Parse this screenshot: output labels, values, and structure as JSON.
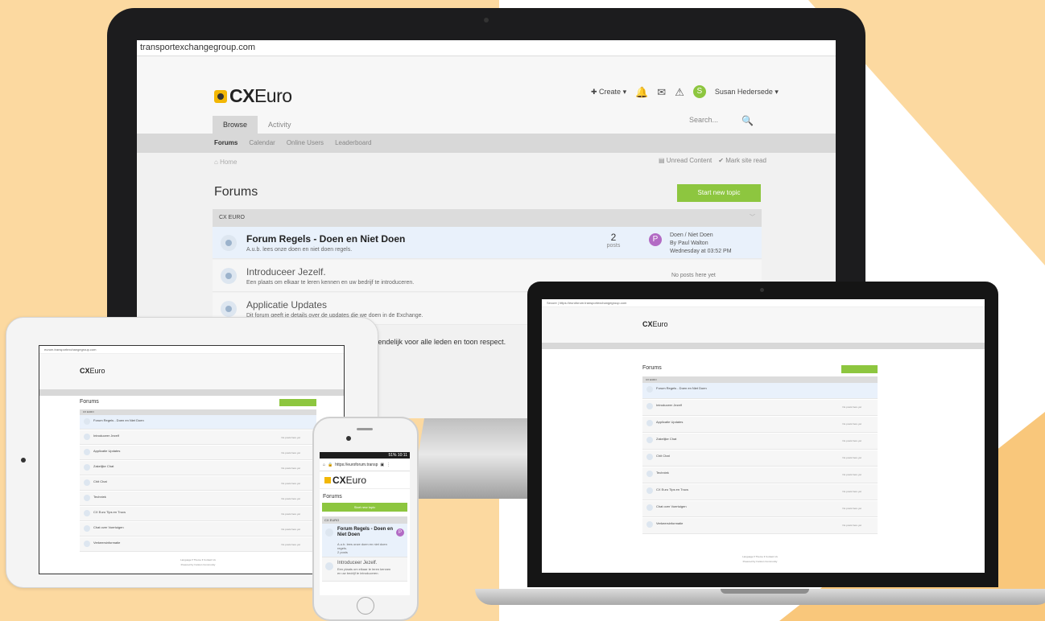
{
  "browser": {
    "desktop_url": "transportexchangegroup.com",
    "laptop_url": "Secure | https://euroforum.transportexchangegroup.com",
    "tablet_url": "eurum.transportexchangegroup.com",
    "phone_url": "https://euroforum.transp",
    "phone_status": "51% 10:11"
  },
  "logo": {
    "brand_bold": "CX",
    "brand_light": "Euro"
  },
  "topnav": {
    "create": "Create",
    "user": "Susan Hedersede"
  },
  "tabs": [
    "Browse",
    "Activity"
  ],
  "search": {
    "placeholder": "Search..."
  },
  "subnav": [
    "Forums",
    "Calendar",
    "Online Users",
    "Leaderboard"
  ],
  "breadcrumb": "Home",
  "actions": {
    "unread": "Unread Content",
    "mark_read": "Mark site read"
  },
  "page_title": "Forums",
  "start_topic": "Start new topic",
  "category": "CX EURO",
  "forums": [
    {
      "title": "Forum Regels - Doen en Niet Doen",
      "desc": "A.u.b. lees onze doen en niet doen regels.",
      "count": "2",
      "count_unit": "posts",
      "last_title": "Doen / Niet Doen",
      "last_by": "By Paul Walton",
      "last_time": "Wednesday at 03:52 PM",
      "avatar": "P"
    },
    {
      "title": "Introduceer Jezelf.",
      "desc": "Een plaats om elkaar te leren kennen en uw bedrijf te introduceren.",
      "no_posts": "No posts here yet"
    },
    {
      "title": "Applicatie Updates",
      "desc": "Dit forum geeft je details over de updates die we doen in de Exchange."
    }
  ],
  "overflow_text": "vriendelijk voor alle leden en toon respect.",
  "mini_forums": [
    "Forum Regels - Doen en Niet Doen",
    "Introduceer Jezelf",
    "Applicatie Updates",
    "Zakelijke Chat",
    "Chit Chat",
    "Techniek",
    "CX Euro Tips en Trucs",
    "Chat over Voertuigen",
    "Verkeersinformatie"
  ],
  "mini_no_posts": "No posts here yet",
  "footer": {
    "links": "Language ▾  Theme ▾  Contact Us",
    "powered": "Powered by Invision Community"
  },
  "phone_rows": [
    {
      "title": "Forum Regels - Doen en Niet Doen",
      "desc": "A.u.b. lees onze doen en niet doen regels.",
      "meta": "2 posts",
      "avatar": "P"
    },
    {
      "title": "Introduceer Jezelf.",
      "desc": "Een plaats om elkaar te leren kennen en uw bedrijf te introduceren."
    }
  ]
}
